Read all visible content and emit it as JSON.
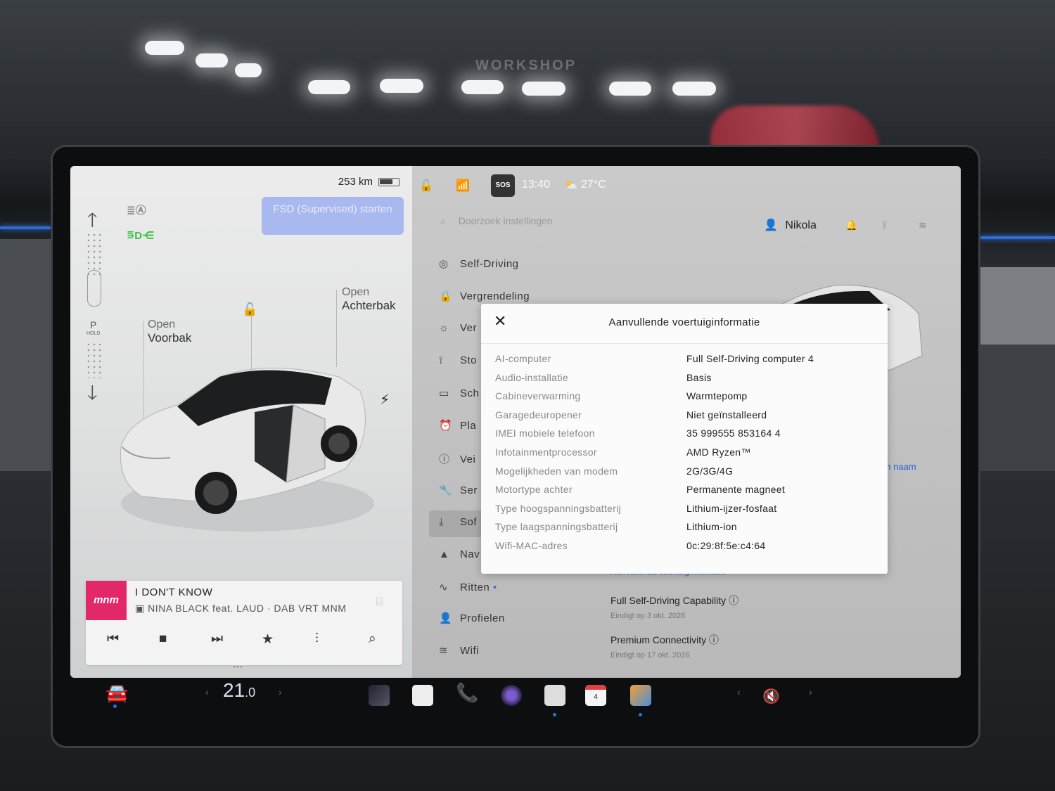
{
  "left": {
    "range": "253 km",
    "fsd_button": "FSD (Supervised) starten",
    "gear_p": "P",
    "gear_hold": "HOLD",
    "trunk_front_top": "Open",
    "trunk_front_bottom": "Voorbak",
    "trunk_rear_top": "Open",
    "trunk_rear_bottom": "Achterbak"
  },
  "music": {
    "station_logo": "mnm",
    "song": "I DON'T KNOW",
    "artist": "NINA BLACK feat. LAUD · DAB VRT MNM"
  },
  "status": {
    "sos": "SOS",
    "time": "13:40",
    "temperature": "27°C"
  },
  "header": {
    "search_placeholder": "Doorzoek instellingen",
    "user": "Nikola"
  },
  "menu": [
    {
      "icon": "steering-wheel-icon",
      "label": "Self-Driving"
    },
    {
      "icon": "lock-icon",
      "label": "Vergrendeling"
    },
    {
      "icon": "sun-icon",
      "label": "Ver"
    },
    {
      "icon": "seat-icon",
      "label": "Sto"
    },
    {
      "icon": "screen-icon",
      "label": "Sch"
    },
    {
      "icon": "alarm-icon",
      "label": "Pla"
    },
    {
      "icon": "info-icon",
      "label": "Vei"
    },
    {
      "icon": "wrench-icon",
      "label": "Ser"
    },
    {
      "icon": "download-icon",
      "label": "Sof"
    },
    {
      "icon": "navigation-icon",
      "label": "Nav"
    },
    {
      "icon": "trips-icon",
      "label": "Ritten"
    },
    {
      "icon": "profile-icon",
      "label": "Profielen"
    },
    {
      "icon": "wifi-icon",
      "label": "Wifi"
    }
  ],
  "software": {
    "link_partial": "en naam",
    "additional_info_link": "Aanvullende voertuiginformatie",
    "fsd_title": "Full Self-Driving Capability",
    "fsd_sub": "Eindigt op 3 okt. 2026",
    "connectivity_title": "Premium Connectivity",
    "connectivity_sub": "Eindigt op 17 okt. 2026"
  },
  "modal": {
    "title": "Aanvullende voertuiginformatie",
    "rows": [
      {
        "key": "AI-computer",
        "value": "Full Self-Driving computer 4"
      },
      {
        "key": "Audio-installatie",
        "value": "Basis"
      },
      {
        "key": "Cabineverwarming",
        "value": "Warmtepomp"
      },
      {
        "key": "Garagedeuropener",
        "value": "Niet geïnstalleerd"
      },
      {
        "key": "IMEI mobiele telefoon",
        "value": "35 999555 853164 4"
      },
      {
        "key": "Infotainmentprocessor",
        "value": "AMD Ryzen™"
      },
      {
        "key": "Mogelijkheden van modem",
        "value": "2G/3G/4G"
      },
      {
        "key": "Motortype achter",
        "value": "Permanente magneet"
      },
      {
        "key": "Type hoogspanningsbatterij",
        "value": "Lithium-ijzer-fosfaat"
      },
      {
        "key": "Type laagspanningsbatterij",
        "value": "Lithium-ion"
      },
      {
        "key": "Wifi-MAC-adres",
        "value": "0c:29:8f:5e:c4:64"
      }
    ]
  },
  "dock": {
    "temperature_main": "21",
    "temperature_decimal": ".0",
    "calendar_day": "4"
  },
  "colors": {
    "fsd_button": "#a9b8ef",
    "station_brand": "#e3286a",
    "accent": "#2d6fe0"
  }
}
